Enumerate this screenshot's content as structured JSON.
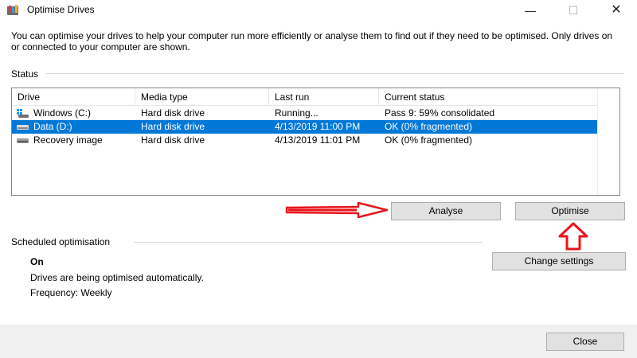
{
  "window": {
    "title": "Optimise Drives"
  },
  "description": "You can optimise your drives to help your computer run more efficiently or analyse them to find out if they need to be optimised. Only drives on or connected to your computer are shown.",
  "status": {
    "label": "Status",
    "columns": [
      "Drive",
      "Media type",
      "Last run",
      "Current status"
    ],
    "rows": [
      {
        "drive": "Windows (C:)",
        "icon": "windows-drive-icon",
        "media_type": "Hard disk drive",
        "last_run": "Running...",
        "current_status": "Pass 9: 59% consolidated",
        "selected": false
      },
      {
        "drive": "Data (D:)",
        "icon": "hard-drive-icon",
        "media_type": "Hard disk drive",
        "last_run": "4/13/2019 11:00 PM",
        "current_status": "OK (0% fragmented)",
        "selected": true
      },
      {
        "drive": "Recovery image",
        "icon": "hard-drive-icon",
        "media_type": "Hard disk drive",
        "last_run": "4/13/2019 11:01 PM",
        "current_status": "OK (0% fragmented)",
        "selected": false
      }
    ]
  },
  "buttons": {
    "analyse": "Analyse",
    "optimise": "Optimise",
    "change_settings": "Change settings",
    "close": "Close"
  },
  "scheduled": {
    "label": "Scheduled optimisation",
    "state": "On",
    "description": "Drives are being optimised automatically.",
    "frequency": "Frequency: Weekly"
  },
  "colors": {
    "selection": "#0078d7",
    "annotation_red": "#e8141c"
  }
}
